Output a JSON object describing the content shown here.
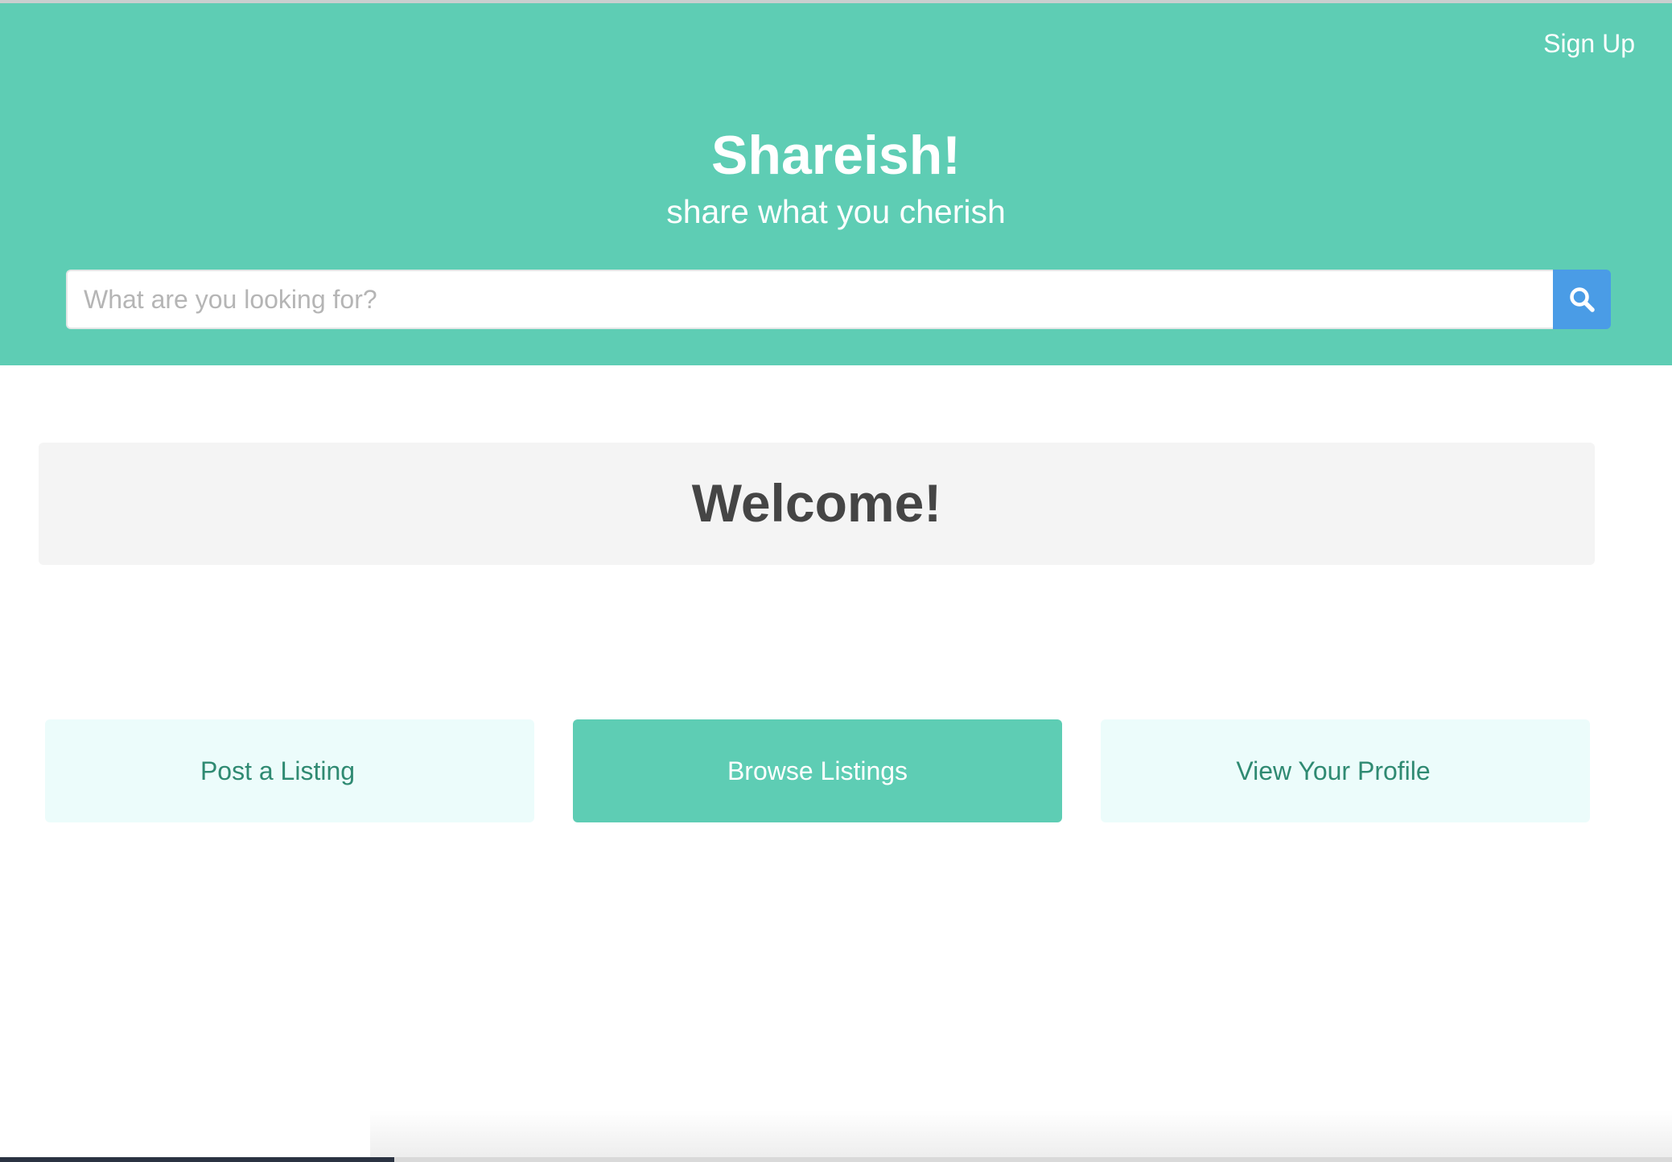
{
  "nav": {
    "signup_label": "Sign Up"
  },
  "brand": {
    "title": "Shareish!",
    "tagline": "share what you cherish"
  },
  "search": {
    "placeholder": "What are you looking for?",
    "value": "",
    "button_icon": "search-icon"
  },
  "welcome": {
    "heading": "Welcome!"
  },
  "actions": {
    "post_label": "Post a Listing",
    "browse_label": "Browse Listings",
    "profile_label": "View Your Profile"
  },
  "colors": {
    "primary": "#5ecdb4",
    "search_button": "#4a9ce6",
    "tile_light": "#ecfcfb",
    "tile_text": "#2f8a72",
    "heading_text": "#454545"
  }
}
